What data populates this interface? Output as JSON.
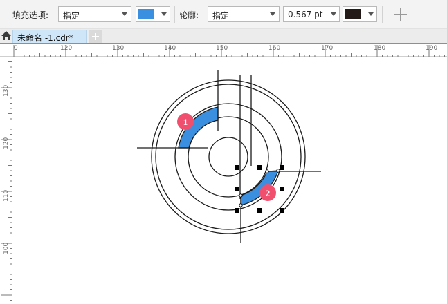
{
  "property_bar": {
    "fill_label": "填充选项:",
    "fill_mode": "指定",
    "fill_color": "#3a8fe0",
    "outline_label": "轮廓:",
    "outline_mode": "指定",
    "outline_width": "0.567 pt",
    "outline_color": "#231a17"
  },
  "tabs": {
    "document_tab": "未命名 -1.cdr*"
  },
  "rulers": {
    "horizontal": [
      "0",
      "120",
      "130",
      "140",
      "150",
      "160",
      "170",
      "180",
      "190"
    ],
    "vertical": [
      "130",
      "120",
      "110",
      "100"
    ]
  },
  "callouts": {
    "one": "1",
    "two": "2"
  },
  "colors": {
    "accent_blue": "#3a8fe0",
    "callout_red": "#f0506e",
    "ruler_line": "#4aa3df"
  }
}
